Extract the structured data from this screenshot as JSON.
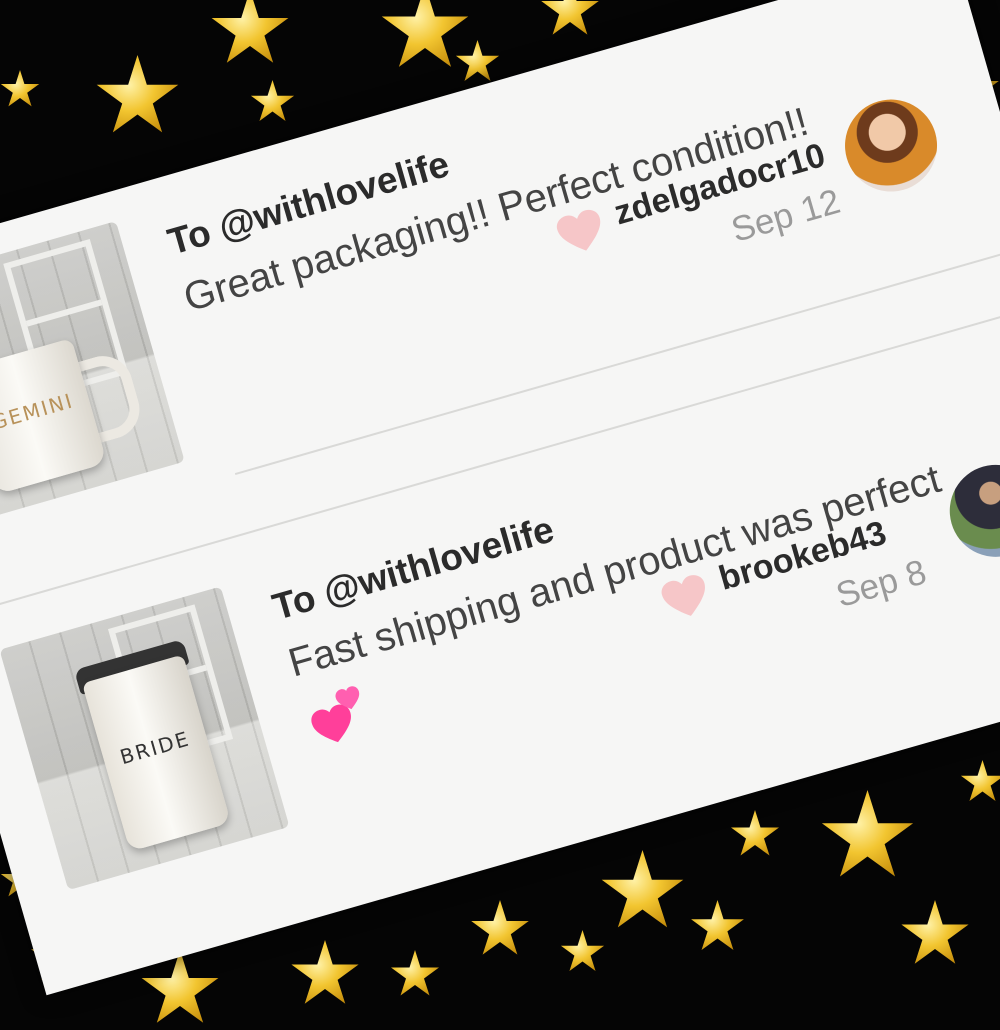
{
  "reviews": [
    {
      "to": "To @withlovelife",
      "message": "Great packaging!! Perfect condition!!",
      "username": "zdelgadocr10",
      "date": "Sep 12",
      "product_text": "GEMINI"
    },
    {
      "to": "To @withlovelife",
      "message": "Fast shipping and product was perfect",
      "username": "brookeb43",
      "date": "Sep 8",
      "product_text": "BRIDE"
    }
  ],
  "colors": {
    "heart": "#f6c6c8",
    "emoji_heart": "#ff3f9a",
    "background": "#050505",
    "star": "#f2c530"
  }
}
